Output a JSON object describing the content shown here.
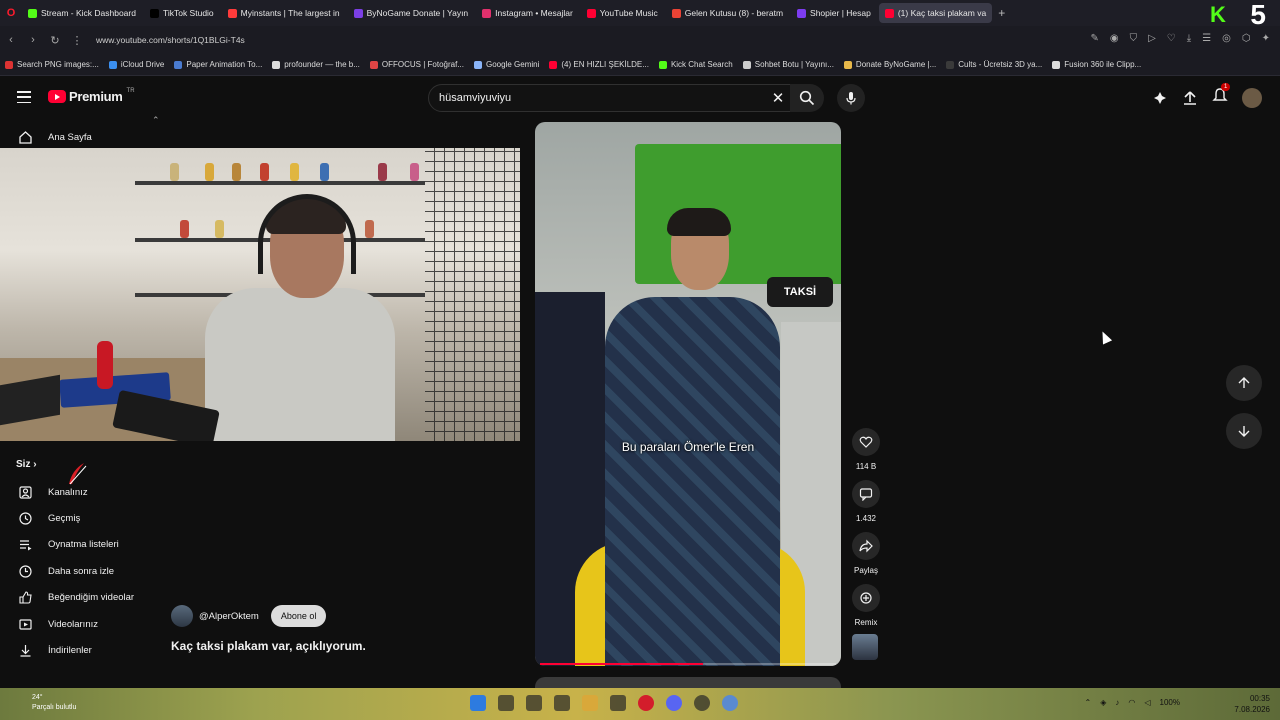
{
  "browser": {
    "tabs": [
      {
        "label": "Stream - Kick Dashboard",
        "color": "#53fc18",
        "active": false
      },
      {
        "label": "TikTok Studio",
        "color": "#000000",
        "active": false
      },
      {
        "label": "Myinstants | The largest in",
        "color": "#ff3b3b",
        "active": false
      },
      {
        "label": "ByNoGame Donate | Yayın",
        "color": "#7b3fe4",
        "active": false
      },
      {
        "label": "Instagram • Mesajlar",
        "color": "#e1306c",
        "active": false
      },
      {
        "label": "YouTube Music",
        "color": "#ff0033",
        "active": false
      },
      {
        "label": "Gelen Kutusu (8) - beratm",
        "color": "#ea4335",
        "active": false
      },
      {
        "label": "Shopier | Hesap",
        "color": "#7d3cf0",
        "active": false
      },
      {
        "label": "(1) Kaç taksi plakam va",
        "color": "#ff0033",
        "active": true
      }
    ],
    "new_tab": "+",
    "overlay_k": "K",
    "overlay_five": "5",
    "url": "www.youtube.com/shorts/1Q1BLGi-T4s",
    "bookmarks": [
      {
        "label": "Search PNG images:...",
        "color": "#d33"
      },
      {
        "label": "iCloud Drive",
        "color": "#3b8ff0"
      },
      {
        "label": "Paper Animation To...",
        "color": "#4a7bd0"
      },
      {
        "label": "profounder — the b...",
        "color": "#ddd"
      },
      {
        "label": "OFFOCUS | Fotoğraf...",
        "color": "#e04545"
      },
      {
        "label": "Google Gemini",
        "color": "#8ab4f8"
      },
      {
        "label": "(4) EN HIZLI ŞEKİLDE...",
        "color": "#ff0033"
      },
      {
        "label": "Kick Chat Search",
        "color": "#53fc18"
      },
      {
        "label": "Sohbet Botu | Yayını...",
        "color": "#ccc"
      },
      {
        "label": "Donate ByNoGame |...",
        "color": "#e8b84a"
      },
      {
        "label": "Cults - Ücretsiz 3D ya...",
        "color": "#3a3a3a"
      },
      {
        "label": "Fusion 360 ile Clipp...",
        "color": "#ddd"
      }
    ]
  },
  "youtube": {
    "logo_text": "Premium",
    "logo_region": "TR",
    "search_value": "hüsamviyuviyu",
    "notification_count": "1",
    "sidebar": {
      "home_label": "Ana Sayfa",
      "you_label": "Siz",
      "items": [
        {
          "label": "Kanalınız",
          "icon": "channel-icon"
        },
        {
          "label": "Geçmiş",
          "icon": "history-icon"
        },
        {
          "label": "Oynatma listeleri",
          "icon": "playlists-icon"
        },
        {
          "label": "Daha sonra izle",
          "icon": "watch-later-icon"
        },
        {
          "label": "Beğendiğim videolar",
          "icon": "liked-icon"
        },
        {
          "label": "Videolarınız",
          "icon": "your-videos-icon"
        },
        {
          "label": "İndirilenler",
          "icon": "downloads-icon"
        }
      ]
    },
    "short": {
      "subtitle": "Bu paraları Ömer'le Eren",
      "sign_text": "TAKSİ",
      "channel": "@AlperOktem",
      "subscribe_label": "Abone ol",
      "title": "Kaç taksi plakam var, açıklıyorum.",
      "likes": "114 B",
      "comments": "1.432",
      "share_label": "Paylaş",
      "remix_label": "Remix",
      "progress": 0.55
    }
  },
  "taskbar": {
    "weather_temp": "24°",
    "weather_desc": "Parçalı bulutlu",
    "battery": "100%",
    "time": "00:35",
    "date": "7.08.2026"
  }
}
